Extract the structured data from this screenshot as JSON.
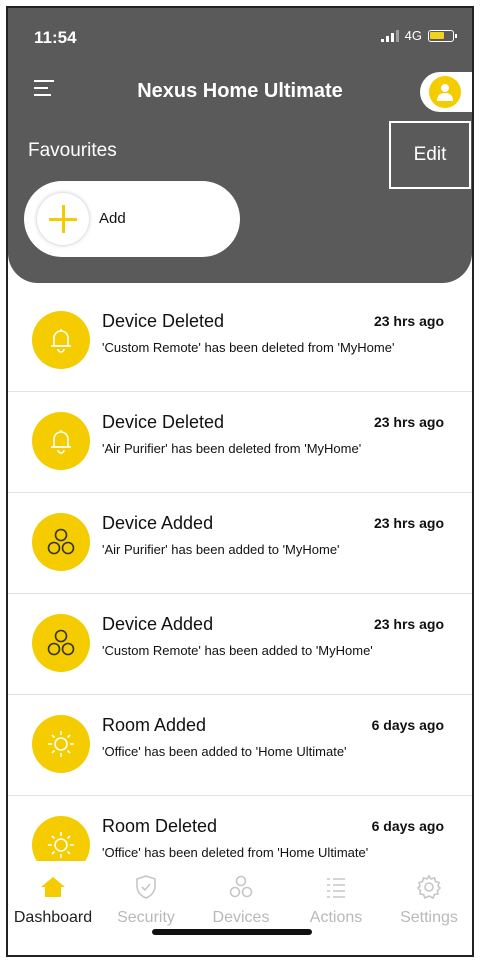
{
  "status_bar": {
    "time": "11:54",
    "network": "4G"
  },
  "header": {
    "title": "Nexus Home Ultimate"
  },
  "favourites": {
    "label": "Favourites",
    "edit_label": "Edit",
    "add_label": "Add"
  },
  "notifications": [
    {
      "icon": "bell-icon",
      "title": "Device Deleted",
      "time": "23 hrs ago",
      "description": "'Custom Remote' has been deleted from 'MyHome'"
    },
    {
      "icon": "bell-icon",
      "title": "Device Deleted",
      "time": "23 hrs ago",
      "description": "'Air Purifier' has been deleted from 'MyHome'"
    },
    {
      "icon": "devices-icon",
      "title": "Device Added",
      "time": "23 hrs ago",
      "description": "'Air Purifier' has been added to 'MyHome'"
    },
    {
      "icon": "devices-icon",
      "title": "Device Added",
      "time": "23 hrs ago",
      "description": "'Custom Remote' has been added to 'MyHome'"
    },
    {
      "icon": "sun-icon",
      "title": "Room Added",
      "time": "6 days ago",
      "description": "'Office' has been added to 'Home Ultimate'"
    },
    {
      "icon": "sun-icon",
      "title": "Room Deleted",
      "time": "6 days ago",
      "description": "'Office' has been deleted from 'Home Ultimate'"
    }
  ],
  "tabs": [
    {
      "label": "Dashboard",
      "icon": "home-icon",
      "active": true
    },
    {
      "label": "Security",
      "icon": "shield-icon",
      "active": false
    },
    {
      "label": "Devices",
      "icon": "devices-icon",
      "active": false
    },
    {
      "label": "Actions",
      "icon": "list-icon",
      "active": false
    },
    {
      "label": "Settings",
      "icon": "gear-icon",
      "active": false
    }
  ],
  "colors": {
    "accent": "#f4cc00",
    "header_bg": "#5a5a5a",
    "inactive_tab": "#b9b9b9"
  }
}
